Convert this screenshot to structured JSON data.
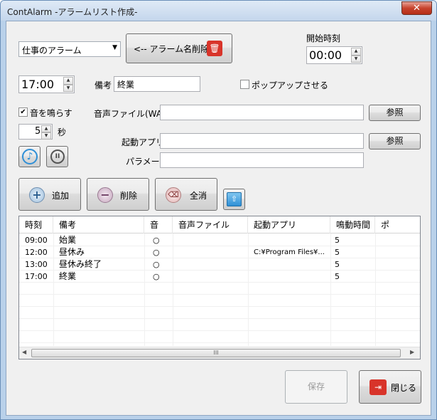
{
  "window": {
    "title": "ContAlarm -アラームリスト作成-",
    "close": "✕"
  },
  "alarm_select": {
    "value": "仕事のアラーム"
  },
  "delete_name_button": {
    "label": "<-- アラーム名削除"
  },
  "start_time": {
    "label": "開始時刻",
    "value": "00:00"
  },
  "alarm_time": {
    "value": "17:00"
  },
  "memo": {
    "label": "備考",
    "value": "終業"
  },
  "popup": {
    "label": "ポップアップさせる",
    "checked": false
  },
  "sound": {
    "label": "音を鳴らす",
    "checked": true,
    "seconds": "5",
    "unit": "秒"
  },
  "sound_file": {
    "label": "音声ファイル(WAV)",
    "value": ""
  },
  "browse_label": "参照",
  "launch_app": {
    "label": "起動アプリ",
    "value": ""
  },
  "param": {
    "label": "パラメータ",
    "value": ""
  },
  "actions": {
    "add": "追加",
    "remove": "削除",
    "clear": "全消"
  },
  "list": {
    "headers": [
      "時刻",
      "備考",
      "音",
      "音声ファイル",
      "起動アプリ",
      "鳴動時間",
      "ポ"
    ],
    "rows": [
      {
        "time": "09:00",
        "memo": "始業",
        "sound": "○",
        "file": "",
        "app": "",
        "dur": "5"
      },
      {
        "time": "12:00",
        "memo": "昼休み",
        "sound": "○",
        "file": "",
        "app": "C:¥Program Files¥...",
        "dur": "5"
      },
      {
        "time": "13:00",
        "memo": "昼休み終了",
        "sound": "○",
        "file": "",
        "app": "",
        "dur": "5"
      },
      {
        "time": "17:00",
        "memo": "終業",
        "sound": "○",
        "file": "",
        "app": "",
        "dur": "5"
      }
    ],
    "scroll_left": "◀",
    "scroll_right": "▶",
    "thumb": "III"
  },
  "footer": {
    "save": "保存",
    "close": "閉じる"
  },
  "colors": {
    "accent_red": "#d8342a",
    "accent_blue": "#2f8fd6"
  }
}
